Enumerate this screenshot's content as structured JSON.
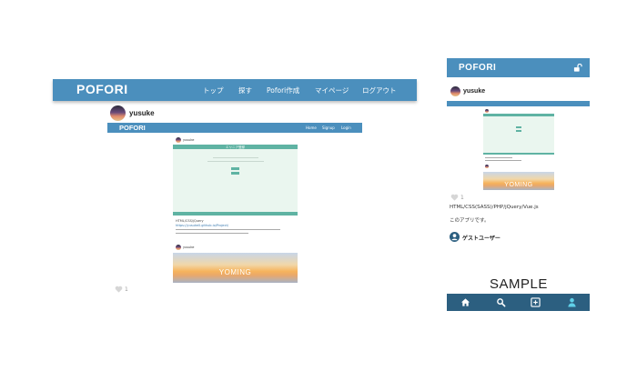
{
  "desktop": {
    "logo": "POFORI",
    "nav": [
      "トップ",
      "探す",
      "Pofori作成",
      "マイページ",
      "ログアウト"
    ],
    "username": "yusuke",
    "screenshot": {
      "logo": "POFORI",
      "nav": [
        "Home",
        "Signup",
        "Login"
      ],
      "card_title": "エリニア登録",
      "username": "yusuke",
      "tech": "HTML/CSS/jQuery",
      "link": "https://yusuke0.github.io/Project/",
      "banner_text": "YOMING"
    },
    "likes": "1"
  },
  "mobile": {
    "logo": "POFORI",
    "username": "yusuke",
    "likes": "1",
    "tech": "HTML/CSS(SASS)/PHP/jQuery/Vue.js",
    "description": "このアプリです。",
    "guest": "ゲストユーザー",
    "banner_text": "YOMING",
    "sample": "SAMPLE"
  },
  "colors": {
    "primary": "#4b8fbd",
    "footer": "#2c5f80",
    "mint": "#eaf6ef",
    "teal": "#5fb3a3"
  },
  "icons": [
    "heart-icon",
    "unlock-icon",
    "home-icon",
    "search-icon",
    "plus-square-icon",
    "user-icon"
  ]
}
